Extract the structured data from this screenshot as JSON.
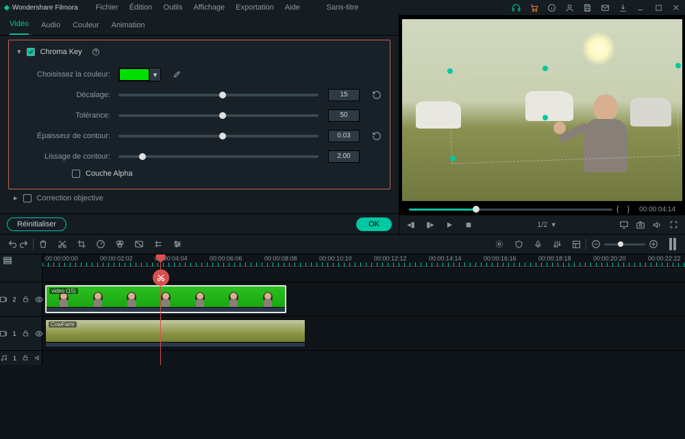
{
  "app": {
    "brand": "Wondershare Filmora",
    "doc_title": "Sans-titre"
  },
  "menu": [
    "Fichier",
    "Édition",
    "Outils",
    "Affichage",
    "Exportation",
    "Aide"
  ],
  "prop_tabs": [
    "Vidéo",
    "Audio",
    "Couleur",
    "Animation"
  ],
  "chroma": {
    "section": "Chroma Key",
    "color_label": "Choisissez la couleur:",
    "color_hex": "#00e000",
    "sliders": {
      "offset": {
        "label": "Décalage:",
        "value": "15",
        "pct": 52,
        "has_reset": true
      },
      "tolerance": {
        "label": "Tolérance:",
        "value": "50",
        "pct": 52,
        "has_reset": false
      },
      "feather": {
        "label": "Épaisseur de contour:",
        "value": "0.03",
        "pct": 52,
        "has_reset": true
      },
      "smooth": {
        "label": "Lissage de contour:",
        "value": "2.00",
        "pct": 12,
        "has_reset": false
      }
    },
    "couche_alpha": "Couche Alpha"
  },
  "correction": "Correction objective",
  "buttons": {
    "reset": "Réinitialiser",
    "ok": "OK"
  },
  "preview": {
    "page": "1/2",
    "timecode": "00:00:04:14"
  },
  "timeline": {
    "ruler": [
      "00:00:00:00",
      "00:00:02:02",
      "00:00:04:04",
      "00:00:06:06",
      "00:00:08:08",
      "00:00:10:10",
      "00:00:12:12",
      "00:00:14:14",
      "00:00:16:16",
      "00:00:18:18",
      "00:00:20:20",
      "00:00:22:22"
    ],
    "track_v2": "2",
    "track_v1": "1",
    "track_a1": "1",
    "clip1": "video (15)",
    "clip2": "CowFarm"
  }
}
